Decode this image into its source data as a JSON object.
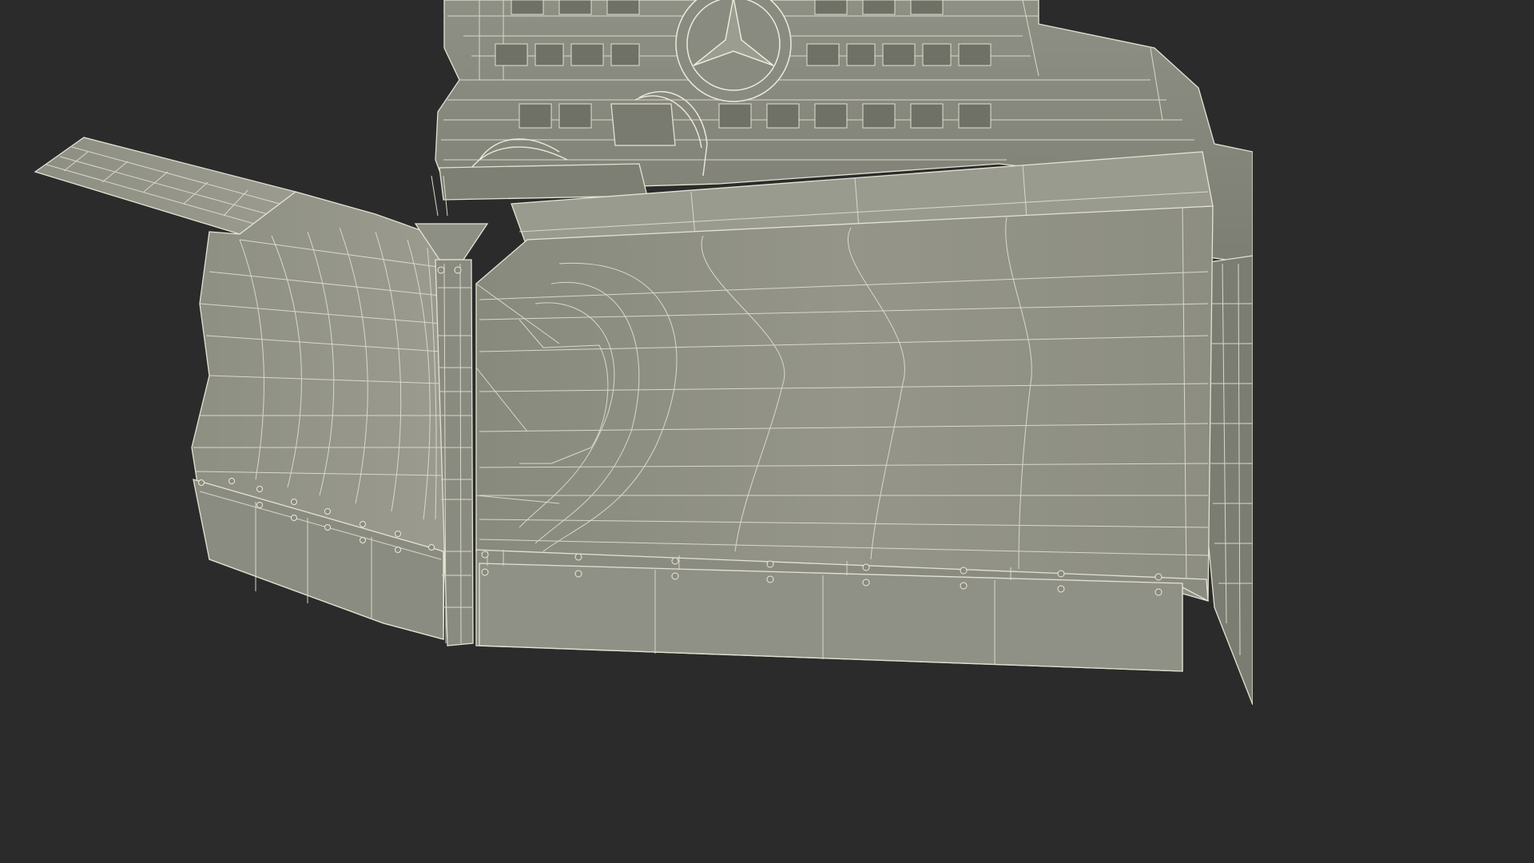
{
  "scene": {
    "subject": "",
    "background_color": "#2b2b2b",
    "mesh_color": "#9a9a8e",
    "wire_color": "#d9d8c8"
  }
}
